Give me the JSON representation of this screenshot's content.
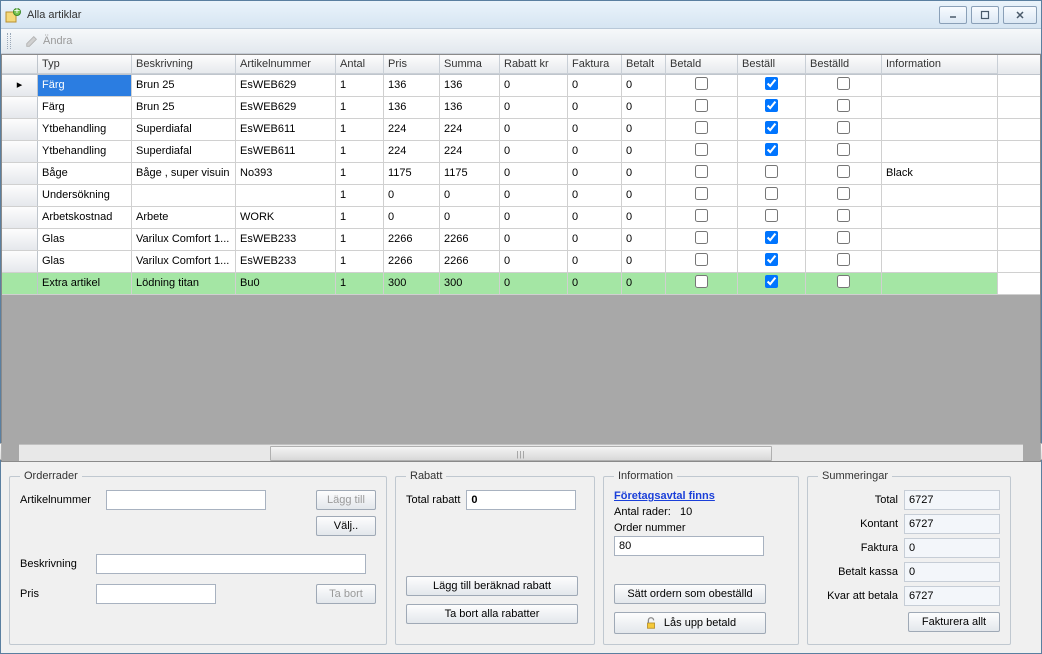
{
  "window": {
    "title": "Alla artiklar"
  },
  "toolbar": {
    "edit_label": "Ändra"
  },
  "columns": {
    "typ": "Typ",
    "beskrivning": "Beskrivning",
    "artikelnummer": "Artikelnummer",
    "antal": "Antal",
    "pris": "Pris",
    "summa": "Summa",
    "rabatt": "Rabatt kr",
    "faktura": "Faktura",
    "betalt": "Betalt",
    "betald": "Betald",
    "bestall": "Beställ",
    "bestalld": "Beställd",
    "information": "Information"
  },
  "rows": [
    {
      "typ": "Färg",
      "besk": "Brun 25",
      "art": "EsWEB629",
      "antal": "1",
      "pris": "136",
      "summa": "136",
      "rab": "0",
      "fak": "0",
      "betalt": "0",
      "betald": false,
      "bestall": true,
      "bestalld": false,
      "info": "",
      "selected": true
    },
    {
      "typ": "Färg",
      "besk": "Brun 25",
      "art": "EsWEB629",
      "antal": "1",
      "pris": "136",
      "summa": "136",
      "rab": "0",
      "fak": "0",
      "betalt": "0",
      "betald": false,
      "bestall": true,
      "bestalld": false,
      "info": ""
    },
    {
      "typ": "Ytbehandling",
      "besk": "Superdiafal",
      "art": "EsWEB611",
      "antal": "1",
      "pris": "224",
      "summa": "224",
      "rab": "0",
      "fak": "0",
      "betalt": "0",
      "betald": false,
      "bestall": true,
      "bestalld": false,
      "info": ""
    },
    {
      "typ": "Ytbehandling",
      "besk": "Superdiafal",
      "art": "EsWEB611",
      "antal": "1",
      "pris": "224",
      "summa": "224",
      "rab": "0",
      "fak": "0",
      "betalt": "0",
      "betald": false,
      "bestall": true,
      "bestalld": false,
      "info": ""
    },
    {
      "typ": "Båge",
      "besk": "Båge , super visuin",
      "art": "No393",
      "antal": "1",
      "pris": "1175",
      "summa": "1175",
      "rab": "0",
      "fak": "0",
      "betalt": "0",
      "betald": false,
      "bestall": false,
      "bestalld": false,
      "info": "Black"
    },
    {
      "typ": "Undersökning",
      "besk": "",
      "art": "",
      "antal": "1",
      "pris": "0",
      "summa": "0",
      "rab": "0",
      "fak": "0",
      "betalt": "0",
      "betald": false,
      "bestall": false,
      "bestalld": false,
      "info": ""
    },
    {
      "typ": "Arbetskostnad",
      "besk": "Arbete",
      "art": "WORK",
      "antal": "1",
      "pris": "0",
      "summa": "0",
      "rab": "0",
      "fak": "0",
      "betalt": "0",
      "betald": false,
      "bestall": false,
      "bestalld": false,
      "info": ""
    },
    {
      "typ": "Glas",
      "besk": "Varilux Comfort 1...",
      "art": "EsWEB233",
      "antal": "1",
      "pris": "2266",
      "summa": "2266",
      "rab": "0",
      "fak": "0",
      "betalt": "0",
      "betald": false,
      "bestall": true,
      "bestalld": false,
      "info": ""
    },
    {
      "typ": "Glas",
      "besk": "Varilux Comfort 1...",
      "art": "EsWEB233",
      "antal": "1",
      "pris": "2266",
      "summa": "2266",
      "rab": "0",
      "fak": "0",
      "betalt": "0",
      "betald": false,
      "bestall": true,
      "bestalld": false,
      "info": ""
    },
    {
      "typ": "Extra artikel",
      "besk": "Lödning titan",
      "art": "Bu0",
      "antal": "1",
      "pris": "300",
      "summa": "300",
      "rab": "0",
      "fak": "0",
      "betalt": "0",
      "betald": false,
      "bestall": true,
      "bestalld": false,
      "info": "",
      "highlight": true
    }
  ],
  "orderrader": {
    "legend": "Orderrader",
    "artikelnummer_label": "Artikelnummer",
    "beskrivning_label": "Beskrivning",
    "pris_label": "Pris",
    "lagg_till": "Lägg till",
    "valj": "Välj..",
    "ta_bort": "Ta bort"
  },
  "rabatt": {
    "legend": "Rabatt",
    "total_label": "Total rabatt",
    "total_value": "0",
    "lagg_till_beraknad": "Lägg till beräknad rabatt",
    "ta_bort_alla": "Ta bort alla rabatter"
  },
  "information": {
    "legend": "Information",
    "foretagsavtal": "Företagsavtal finns",
    "antal_rader_label": "Antal rader:",
    "antal_rader_value": "10",
    "order_nummer_label": "Order nummer",
    "order_nummer_value": "80",
    "satt_obestalld": "Sätt ordern som obeställd",
    "las_upp": "Lås upp betald"
  },
  "summeringar": {
    "legend": "Summeringar",
    "total_label": "Total",
    "total_value": "6727",
    "kontant_label": "Kontant",
    "kontant_value": "6727",
    "faktura_label": "Faktura",
    "faktura_value": "0",
    "betalt_label": "Betalt kassa",
    "betalt_value": "0",
    "kvar_label": "Kvar att betala",
    "kvar_value": "6727",
    "fakturera": "Fakturera allt"
  }
}
